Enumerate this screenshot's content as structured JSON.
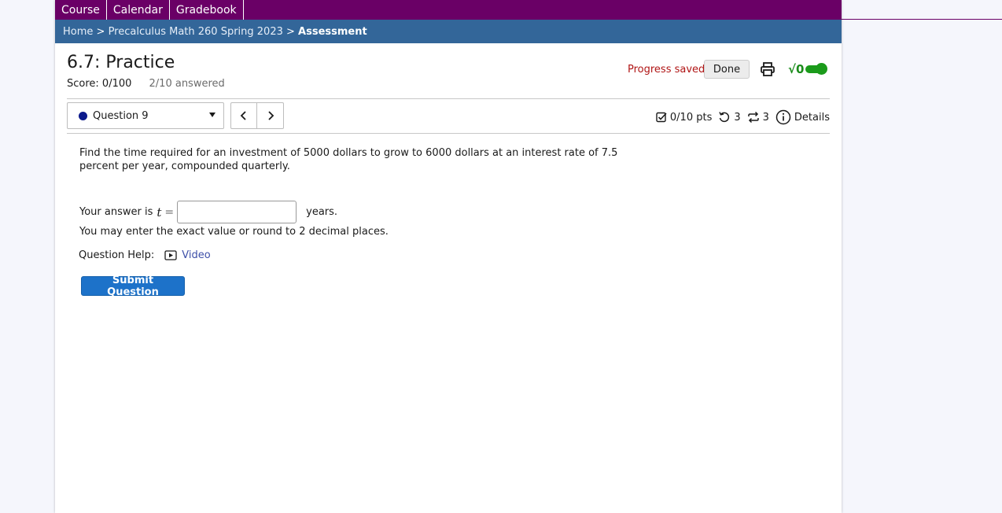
{
  "nav": {
    "items": [
      "Course",
      "Calendar",
      "Gradebook"
    ]
  },
  "breadcrumb": {
    "home": "Home",
    "separator": " > ",
    "course": "Precalculus Math 260 Spring 2023",
    "current": "Assessment"
  },
  "assessment": {
    "title": "6.7: Practice",
    "score": "Score: 0/100",
    "answered": "2/10 answered"
  },
  "status": {
    "progress_saved": "Progress saved",
    "done_label": "Done",
    "math_toggle_label": "√0",
    "math_toggle_on": true
  },
  "question_nav": {
    "selected": "Question 9",
    "prev_label": "<",
    "next_label": ">"
  },
  "question_meta": {
    "points": "0/10 pts",
    "retries": "3",
    "regenerations": "3",
    "details_label": "Details"
  },
  "question": {
    "text": "Find the time required for an investment of 5000 dollars to grow to 6000 dollars at an interest rate of 7.5 percent per year, compounded quarterly.",
    "answer_prefix": "Your answer is",
    "answer_variable": "t",
    "answer_equals": "=",
    "answer_value": "",
    "answer_units": "years.",
    "hint": "You may enter the exact value or round to 2 decimal places.",
    "help_label": "Question Help:",
    "video_label": "Video",
    "submit_label": "Submit Question"
  },
  "colors": {
    "nav_bg": "#6a0066",
    "breadcrumb_bg": "#336699",
    "submit_bg": "#1d72c9",
    "progress_saved": "#b01515",
    "toggle_on": "#1b9b1b"
  }
}
